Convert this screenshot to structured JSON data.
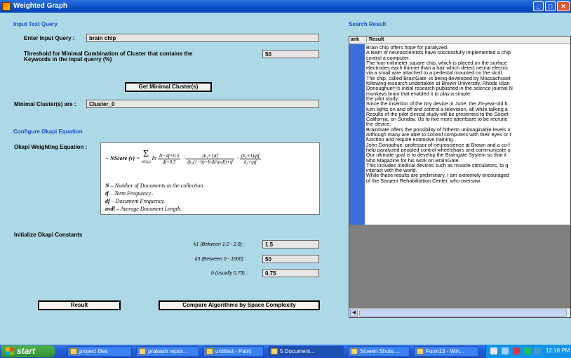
{
  "window": {
    "title": "Weighted Graph"
  },
  "input_section": {
    "heading": "Input Text Query",
    "query_label": "Enter Input Query :",
    "query_value": "brain chip",
    "threshold_label_line1": "Threshold for Minimal Combination of Cluster that contains the",
    "threshold_label_line2": "Keywords in the input querry (%)",
    "threshold_value": "50",
    "get_clusters_button": "Get Minimal Cluster(s)",
    "minimal_clusters_label": "Minimal Cluster(s) are :",
    "minimal_clusters_value": "Cluster_0"
  },
  "okapi": {
    "heading": "Configure Okapi Equation",
    "equation_label": "Okapi Weighting Equation :",
    "definitions": [
      {
        "symbol": "N",
        "text": " – Number of Documents in the collection."
      },
      {
        "symbol": "tf",
        "text": " – Term Frequency ."
      },
      {
        "symbol": "df",
        "text": " – Document Frequency."
      },
      {
        "symbol": "avdl",
        "text": " – Average Document Length."
      }
    ]
  },
  "constants": {
    "heading": "Initialize Okapi Constants",
    "k1_label": "k1 (Between 1.0 - 2.0) :",
    "k1_value": "1.5",
    "k3_label": "k3 (Between 0 - 1000) :",
    "k3_value": "50",
    "b_label": "b (usually 0.75) :",
    "b_value": "0.75"
  },
  "buttons": {
    "result": "Result",
    "compare": "Compare Algorithms by Space Complexity"
  },
  "search_result": {
    "heading": "Search Result",
    "columns": [
      "ank",
      "Result"
    ],
    "lines": [
      "Brain chip offers hope for paralyzed.",
      "A team of neuroscientists have successfully implemented a chip",
      "control a computer.",
      " The four-milimeter square chip, which is placed on the surface",
      "electrodes each thinner than a hair which detect neural electric",
      "via a small wire attached to a pedestal mounted on the skull.",
      "The chip, called BrainGate ,is being developed by Massachuset",
      "following research undertaken at Brown University, Rhode Islan",
      " Donoughue\u0012s initial research published in the science journal N",
      "monkeys brain that enabled it to play a simple",
      "the pilot study.",
      "Since the insertion of the tiny device in June, the 25-year-old h",
      "turn lights on and off and control a television, all while talking a",
      "Results of the pilot clinical study will be presented to the Societ",
      "California, on Sunday. Up to five more atientsare to be recruite",
      "the device.",
      "BrainGate offers the possibility of hitherto unimaginable levels o",
      "Although many are able to control computers with their eyes or t",
      "function and require extensive training.",
      "John Donoghue, professor of neuroscience at Brown and a co-f",
      "help paralyzed peopled control wheelchairs and communicate u",
      "Our ultimate goal is to develop the Braingate System so that it",
      "who Magazine for his work on BrainGate.",
      " This includes medical devices such as muscle stimulators, to g",
      "interact with the world.",
      " While these results are preliminary, I am extremely encouraged",
      "of the Sargent Rehabilitation Center, who oversaw"
    ]
  },
  "taskbar": {
    "start_label": "start",
    "tasks": [
      "project files",
      "prakash repor...",
      "untitled - Paint",
      "5 Document...",
      "Screen Shots....",
      "Form13 - Win..."
    ],
    "clock": "12:18 PM"
  }
}
